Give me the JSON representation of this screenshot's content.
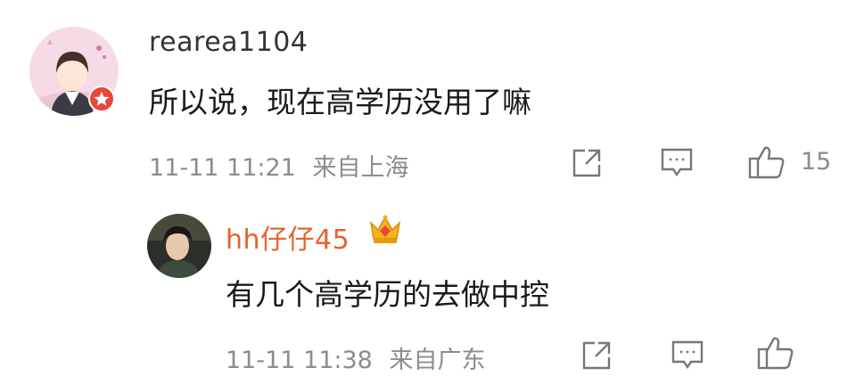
{
  "comments": [
    {
      "username": "rearea1104",
      "text": "所以说，现在高学历没用了嘛",
      "time": "11-11 11:21",
      "location": "来自上海",
      "like_count": "15",
      "username_color": "#333333"
    },
    {
      "username": "hh仔仔45",
      "text": "有几个高学历的去做中控",
      "time": "11-11 11:38",
      "location": "来自广东",
      "username_color": "#e8622a"
    }
  ],
  "icons": {
    "share": "share-icon",
    "reply": "comment-icon",
    "like": "thumbs-up-icon",
    "badge_1": "verified-badge-icon",
    "badge_2": "crown-badge-icon"
  }
}
